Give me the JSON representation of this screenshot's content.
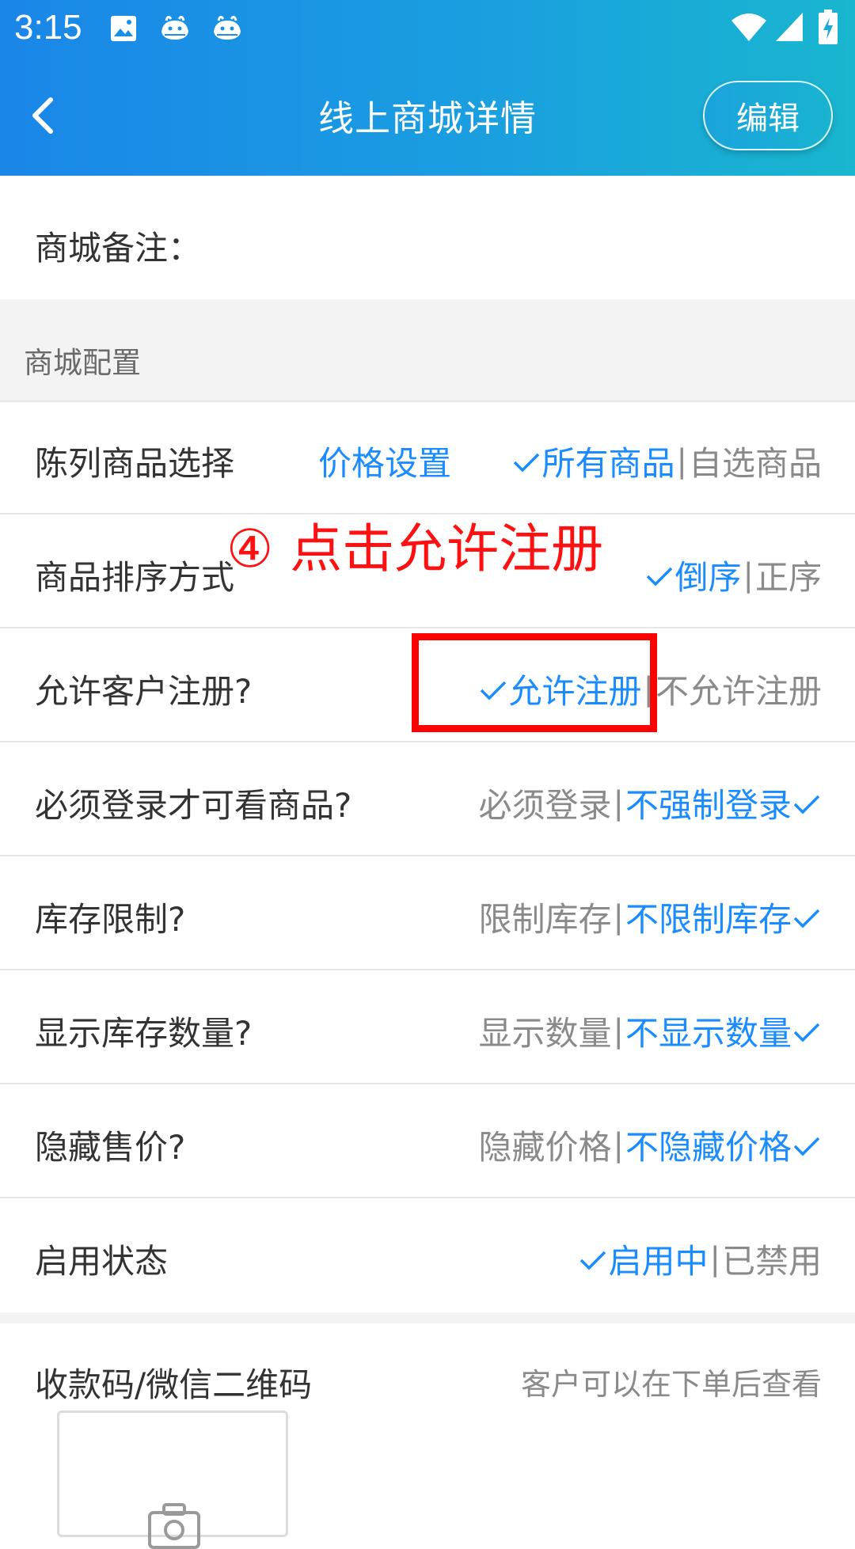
{
  "status_bar": {
    "time": "3:15",
    "icons": [
      "image-icon",
      "app-whale-icon",
      "app-whale-icon",
      "wifi-icon",
      "signal-icon",
      "battery-charging-icon"
    ]
  },
  "toolbar": {
    "title": "线上商城详情",
    "edit_label": "编辑",
    "back_icon": "chevron-left-icon"
  },
  "remark": {
    "label": "商城备注："
  },
  "section": {
    "title": "商城配置"
  },
  "rows": {
    "display_goods": {
      "label": "陈列商品选择",
      "price_link": "价格设置",
      "option_on": "所有商品",
      "option_off": "自选商品"
    },
    "sort": {
      "label": "商品排序方式",
      "option_on": "倒序",
      "option_off": "正序"
    },
    "register": {
      "label": "允许客户注册?",
      "option_on": "允许注册",
      "option_off": "不允许注册"
    },
    "login": {
      "label": "必须登录才可看商品?",
      "option_off": "必须登录",
      "option_on": "不强制登录"
    },
    "stock_limit": {
      "label": "库存限制?",
      "option_off": "限制库存",
      "option_on": "不限制库存"
    },
    "stock_show": {
      "label": "显示库存数量?",
      "option_off": "显示数量",
      "option_on": "不显示数量"
    },
    "hide_price": {
      "label": "隐藏售价?",
      "option_off": "隐藏价格",
      "option_on": "不隐藏价格"
    },
    "enabled": {
      "label": "启用状态",
      "option_on": "启用中",
      "option_off": "已禁用"
    }
  },
  "payment": {
    "label": "收款码/微信二维码",
    "hint": "客户可以在下单后查看"
  },
  "annotation": {
    "text": "④ 点击允许注册"
  },
  "colors": {
    "accent": "#1a8cff",
    "header_start": "#1a86e8",
    "header_end": "#19b6cf",
    "annotation": "#ff0000"
  }
}
